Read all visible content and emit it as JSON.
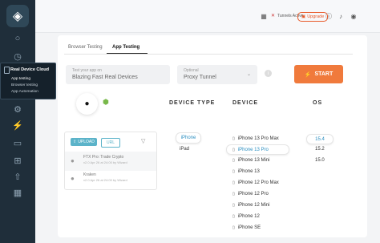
{
  "sidebar": {
    "flyout": {
      "title": "Real Device Cloud",
      "items": [
        "App testing",
        "Browser testing",
        "App Automation"
      ]
    }
  },
  "topbar": {
    "tunnel_label": "Tunnels Active",
    "upgrade_label": "Upgrade"
  },
  "tabs": [
    "Browser Testing",
    "App Testing"
  ],
  "app_field": {
    "label": "Test your app on",
    "value": "Blazing Fast Real Devices"
  },
  "proxy_field": {
    "label": "Optional",
    "value": "Proxy Tunnel"
  },
  "start_label": "START",
  "columns": [
    "DEVICE TYPE",
    "DEVICE",
    "OS"
  ],
  "upload": {
    "upload_label": "UPLOAD",
    "url_label": "URL",
    "apps": [
      {
        "name": "FTX Pro: Trade Crypto",
        "meta": "v2.0 Apr 26 at 24:00 by Wizard"
      },
      {
        "name": "Kraken",
        "meta": "v2.0 Apr 26 at 24:00 by Wizard"
      }
    ]
  },
  "device_types": [
    "iPhone",
    "iPad"
  ],
  "devices": [
    "iPhone 13 Pro Max",
    "iPhone 13 Pro",
    "iPhone 13 Mini",
    "iPhone 13",
    "iPhone 12 Pro Max",
    "iPhone 12 Pro",
    "iPhone 12 Mini",
    "iPhone 12",
    "iPhone SE"
  ],
  "os_versions": [
    "15.4",
    "15.2",
    "15.0"
  ],
  "colors": {
    "accent": "#f07a3c",
    "selected": "#2b8ec0",
    "sidebar": "#1f2e3a"
  }
}
